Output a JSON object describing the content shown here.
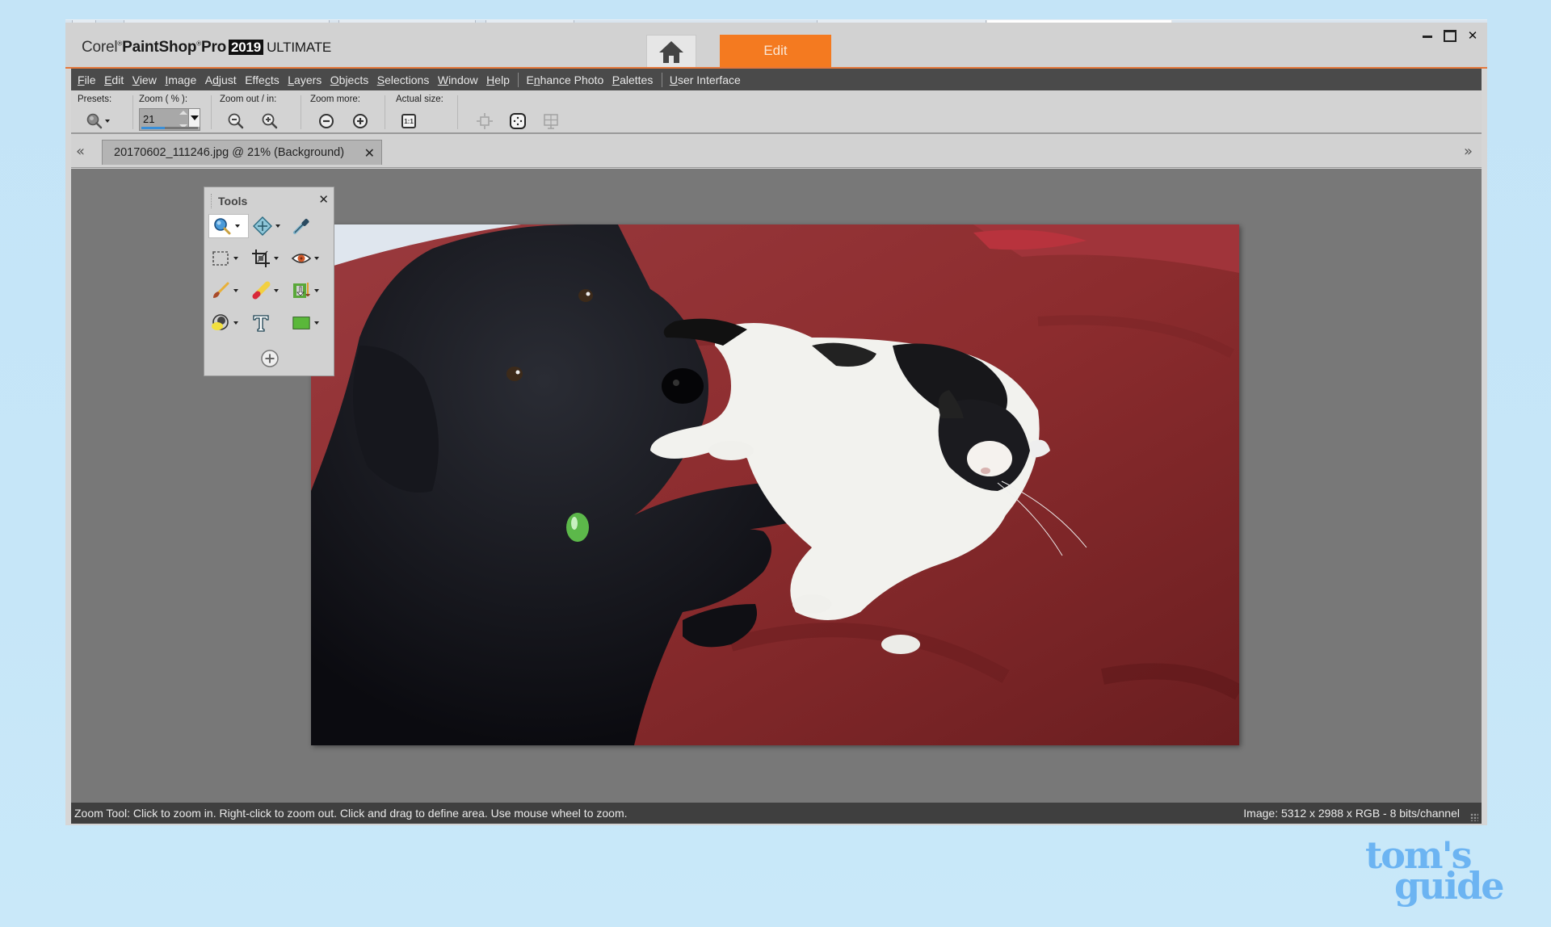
{
  "app": {
    "brand": "Corel",
    "product": "PaintShop",
    "product_suffix": "Pro",
    "year": "2019",
    "edition": "ULTIMATE",
    "workspace_tabs": {
      "home_icon": "home-icon",
      "edit_label": "Edit"
    },
    "window_controls": {
      "minimize": "minimize",
      "maximize": "maximize",
      "close": "✕"
    },
    "accent_color": "#f47a20"
  },
  "menu": {
    "items": [
      {
        "label": "File",
        "mnemonic": "F"
      },
      {
        "label": "Edit",
        "mnemonic": "E"
      },
      {
        "label": "View",
        "mnemonic": "V"
      },
      {
        "label": "Image",
        "mnemonic": "I"
      },
      {
        "label": "Adjust",
        "mnemonic": "d"
      },
      {
        "label": "Effects",
        "mnemonic": "c"
      },
      {
        "label": "Layers",
        "mnemonic": "L"
      },
      {
        "label": "Objects",
        "mnemonic": "O"
      },
      {
        "label": "Selections",
        "mnemonic": "S"
      },
      {
        "label": "Window",
        "mnemonic": "W"
      },
      {
        "label": "Help",
        "mnemonic": "H"
      }
    ],
    "extra_items": [
      {
        "label": "Enhance Photo",
        "mnemonic": "n"
      },
      {
        "label": "Palettes",
        "mnemonic": "P"
      }
    ],
    "ui_item": {
      "label": "User Interface",
      "mnemonic": "U"
    }
  },
  "toolbar": {
    "presets_label": "Presets:",
    "zoom_label": "Zoom ( % ):",
    "zoom_value": "21",
    "zoom_out_in_label": "Zoom out / in:",
    "zoom_more_label": "Zoom more:",
    "actual_size_label": "Actual size:",
    "actual_size_icon_text": "1:1"
  },
  "document_tab": {
    "title": "20170602_111246.jpg @  21% (Background)",
    "close": "✕",
    "prev": "«",
    "next": "»"
  },
  "tools_palette": {
    "title": "Tools",
    "close": "✕",
    "tools": [
      {
        "name": "zoom-tool",
        "icon": "magnifier-icon",
        "has_dropdown": true,
        "active": true
      },
      {
        "name": "pan-tool",
        "icon": "move-arrows-icon",
        "has_dropdown": true
      },
      {
        "name": "dropper-tool",
        "icon": "eyedropper-icon",
        "has_dropdown": false
      },
      {
        "name": "selection-tool",
        "icon": "marquee-icon",
        "has_dropdown": true
      },
      {
        "name": "crop-tool",
        "icon": "crop-icon",
        "has_dropdown": true
      },
      {
        "name": "red-eye-tool",
        "icon": "eye-icon",
        "has_dropdown": true
      },
      {
        "name": "paint-brush-tool",
        "icon": "brush-icon",
        "has_dropdown": true
      },
      {
        "name": "eraser-tool",
        "icon": "eraser-icon",
        "has_dropdown": true
      },
      {
        "name": "smart-carver-tool",
        "icon": "carver-icon",
        "has_dropdown": true
      },
      {
        "name": "fill-tool",
        "icon": "flood-fill-icon",
        "has_dropdown": true
      },
      {
        "name": "text-tool",
        "icon": "text-icon",
        "has_dropdown": false
      },
      {
        "name": "shape-tool",
        "icon": "rectangle-shape-icon",
        "has_dropdown": true
      }
    ]
  },
  "canvas": {
    "image_description": "Photo of a black dog and a black-and-white cat lying on a red blanket"
  },
  "status": {
    "message": "Zoom Tool: Click to zoom in. Right-click to zoom out. Click and drag to define area. Use mouse wheel to zoom.",
    "image_info": "Image:  5312 x 2988 x RGB - 8 bits/channel"
  },
  "watermark": {
    "line1": "tom's",
    "line2": "guide"
  }
}
